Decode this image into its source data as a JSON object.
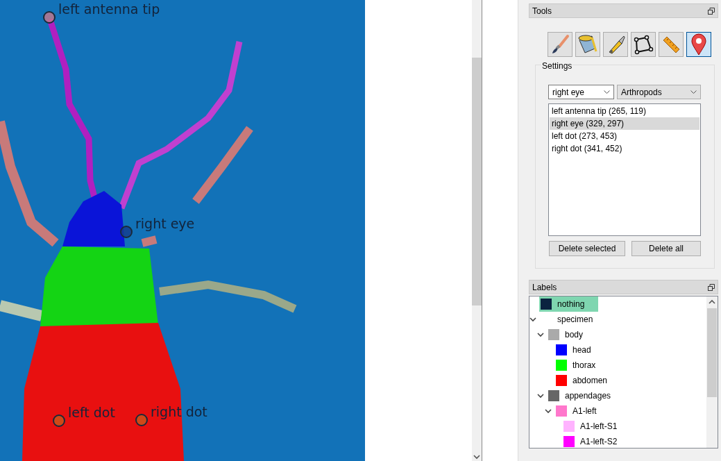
{
  "canvas": {
    "annotations": [
      {
        "label": "left antenna tip"
      },
      {
        "label": "right eye"
      },
      {
        "label": "left dot"
      },
      {
        "label": "right dot"
      }
    ]
  },
  "tools": {
    "title": "Tools",
    "buttons": [
      {
        "kind": "brush",
        "selected": false
      },
      {
        "kind": "bucket",
        "selected": false
      },
      {
        "kind": "cutter",
        "selected": false
      },
      {
        "kind": "polygon",
        "selected": false
      },
      {
        "kind": "ruler",
        "selected": false
      },
      {
        "kind": "pin",
        "selected": true
      }
    ]
  },
  "settings": {
    "title": "Settings",
    "label_select": "right eye",
    "scheme_select": "Arthropods",
    "points": [
      {
        "text": "left antenna tip (265, 119)",
        "selected": false
      },
      {
        "text": "right eye (329, 297)",
        "selected": true
      },
      {
        "text": "left dot (273, 453)",
        "selected": false
      },
      {
        "text": "right dot (341, 452)",
        "selected": false
      }
    ],
    "buttons": [
      "Delete selected",
      "Delete all"
    ]
  },
  "labels": {
    "title": "Labels",
    "tree": [
      {
        "name": "nothing",
        "color": "#0b2340",
        "selected": true
      },
      {
        "name": "specimen",
        "expanded": true,
        "selected": false,
        "children": [
          {
            "name": "body",
            "color": "#aaaaaa",
            "expanded": true,
            "selected": false,
            "children": [
              {
                "name": "head",
                "color": "#0000ff",
                "selected": false
              },
              {
                "name": "thorax",
                "color": "#00ff00",
                "selected": false
              },
              {
                "name": "abdomen",
                "color": "#ff0000",
                "selected": false
              }
            ]
          },
          {
            "name": "appendages",
            "color": "#666666",
            "expanded": true,
            "selected": false,
            "children": [
              {
                "name": "A1-left",
                "color": "#ff77cc",
                "expanded": true,
                "selected": false,
                "children": [
                  {
                    "name": "A1-left-S1",
                    "color": "#ffb3ff",
                    "selected": false
                  },
                  {
                    "name": "A1-left-S2",
                    "color": "#ff00ff",
                    "selected": false
                  }
                ]
              }
            ]
          }
        ]
      }
    ]
  }
}
